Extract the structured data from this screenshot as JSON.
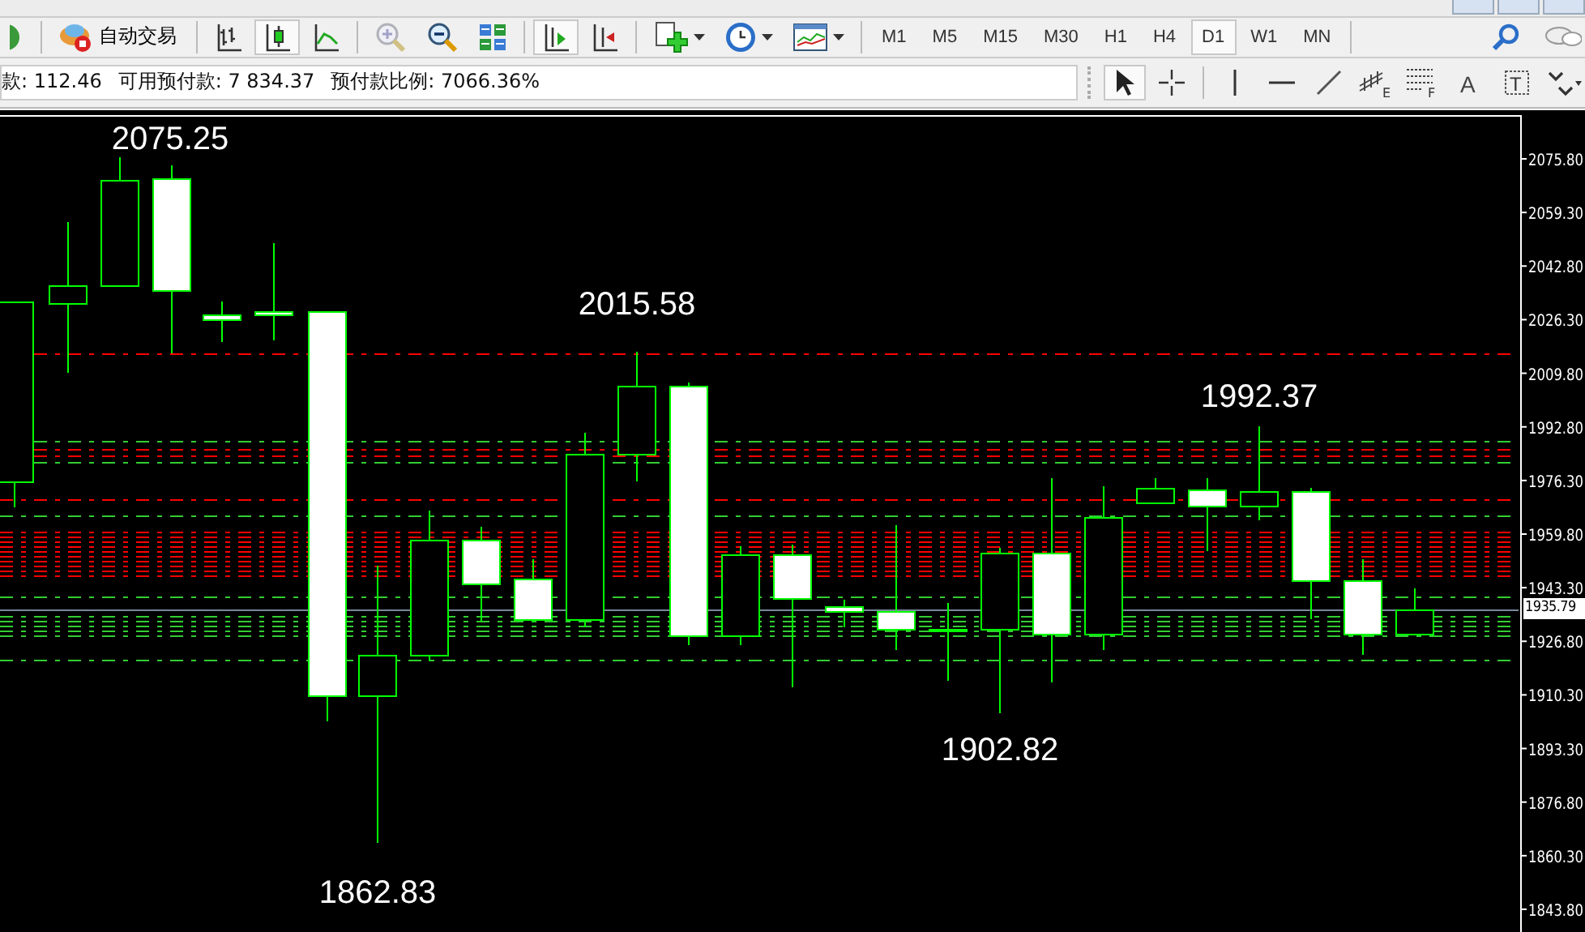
{
  "toolbar": {
    "auto_trading": {
      "label": "自动交易"
    },
    "chart_types": [
      {
        "kind": "bars",
        "selected": false
      },
      {
        "kind": "candles",
        "selected": true
      },
      {
        "kind": "line",
        "selected": false
      }
    ],
    "zoom_in": {
      "disabled": true
    },
    "auto_scroll": {
      "selected": true
    },
    "chart_shift": {
      "selected": false
    },
    "timeframes": [
      {
        "label": "M1",
        "selected": false
      },
      {
        "label": "M5",
        "selected": false
      },
      {
        "label": "M15",
        "selected": false
      },
      {
        "label": "M30",
        "selected": false
      },
      {
        "label": "H1",
        "selected": false
      },
      {
        "label": "H4",
        "selected": false
      },
      {
        "label": "D1",
        "selected": true
      },
      {
        "label": "W1",
        "selected": false
      },
      {
        "label": "MN",
        "selected": false
      }
    ]
  },
  "account_info": [
    "款: 112.46",
    "可用预付款: 7 834.37",
    "预付款比例: 7066.36%"
  ],
  "drawing_tools": [
    {
      "kind": "cursor",
      "selected": true
    },
    {
      "kind": "crosshair",
      "selected": false
    },
    {
      "kind": "vline",
      "selected": false
    },
    {
      "kind": "hline",
      "selected": false
    },
    {
      "kind": "trendline",
      "selected": false
    },
    {
      "kind": "channel",
      "label": "E",
      "selected": false
    },
    {
      "kind": "fibo",
      "label": "F",
      "selected": false
    },
    {
      "kind": "text",
      "label": "A",
      "selected": false
    },
    {
      "kind": "label",
      "label": "T",
      "selected": false
    },
    {
      "kind": "arrows",
      "selected": false
    }
  ],
  "chart": {
    "price_labels": [
      "2075.25",
      "2015.58",
      "1992.37",
      "1902.82",
      "1862.83"
    ],
    "axis_ticks": [
      "2075.80",
      "2059.30",
      "2042.80",
      "2026.30",
      "2009.80",
      "1992.80",
      "1976.30",
      "1959.80",
      "1943.30",
      "1926.80",
      "1910.30",
      "1893.30",
      "1876.80",
      "1860.30",
      "1843.80"
    ],
    "current_price": "1935.79"
  }
}
